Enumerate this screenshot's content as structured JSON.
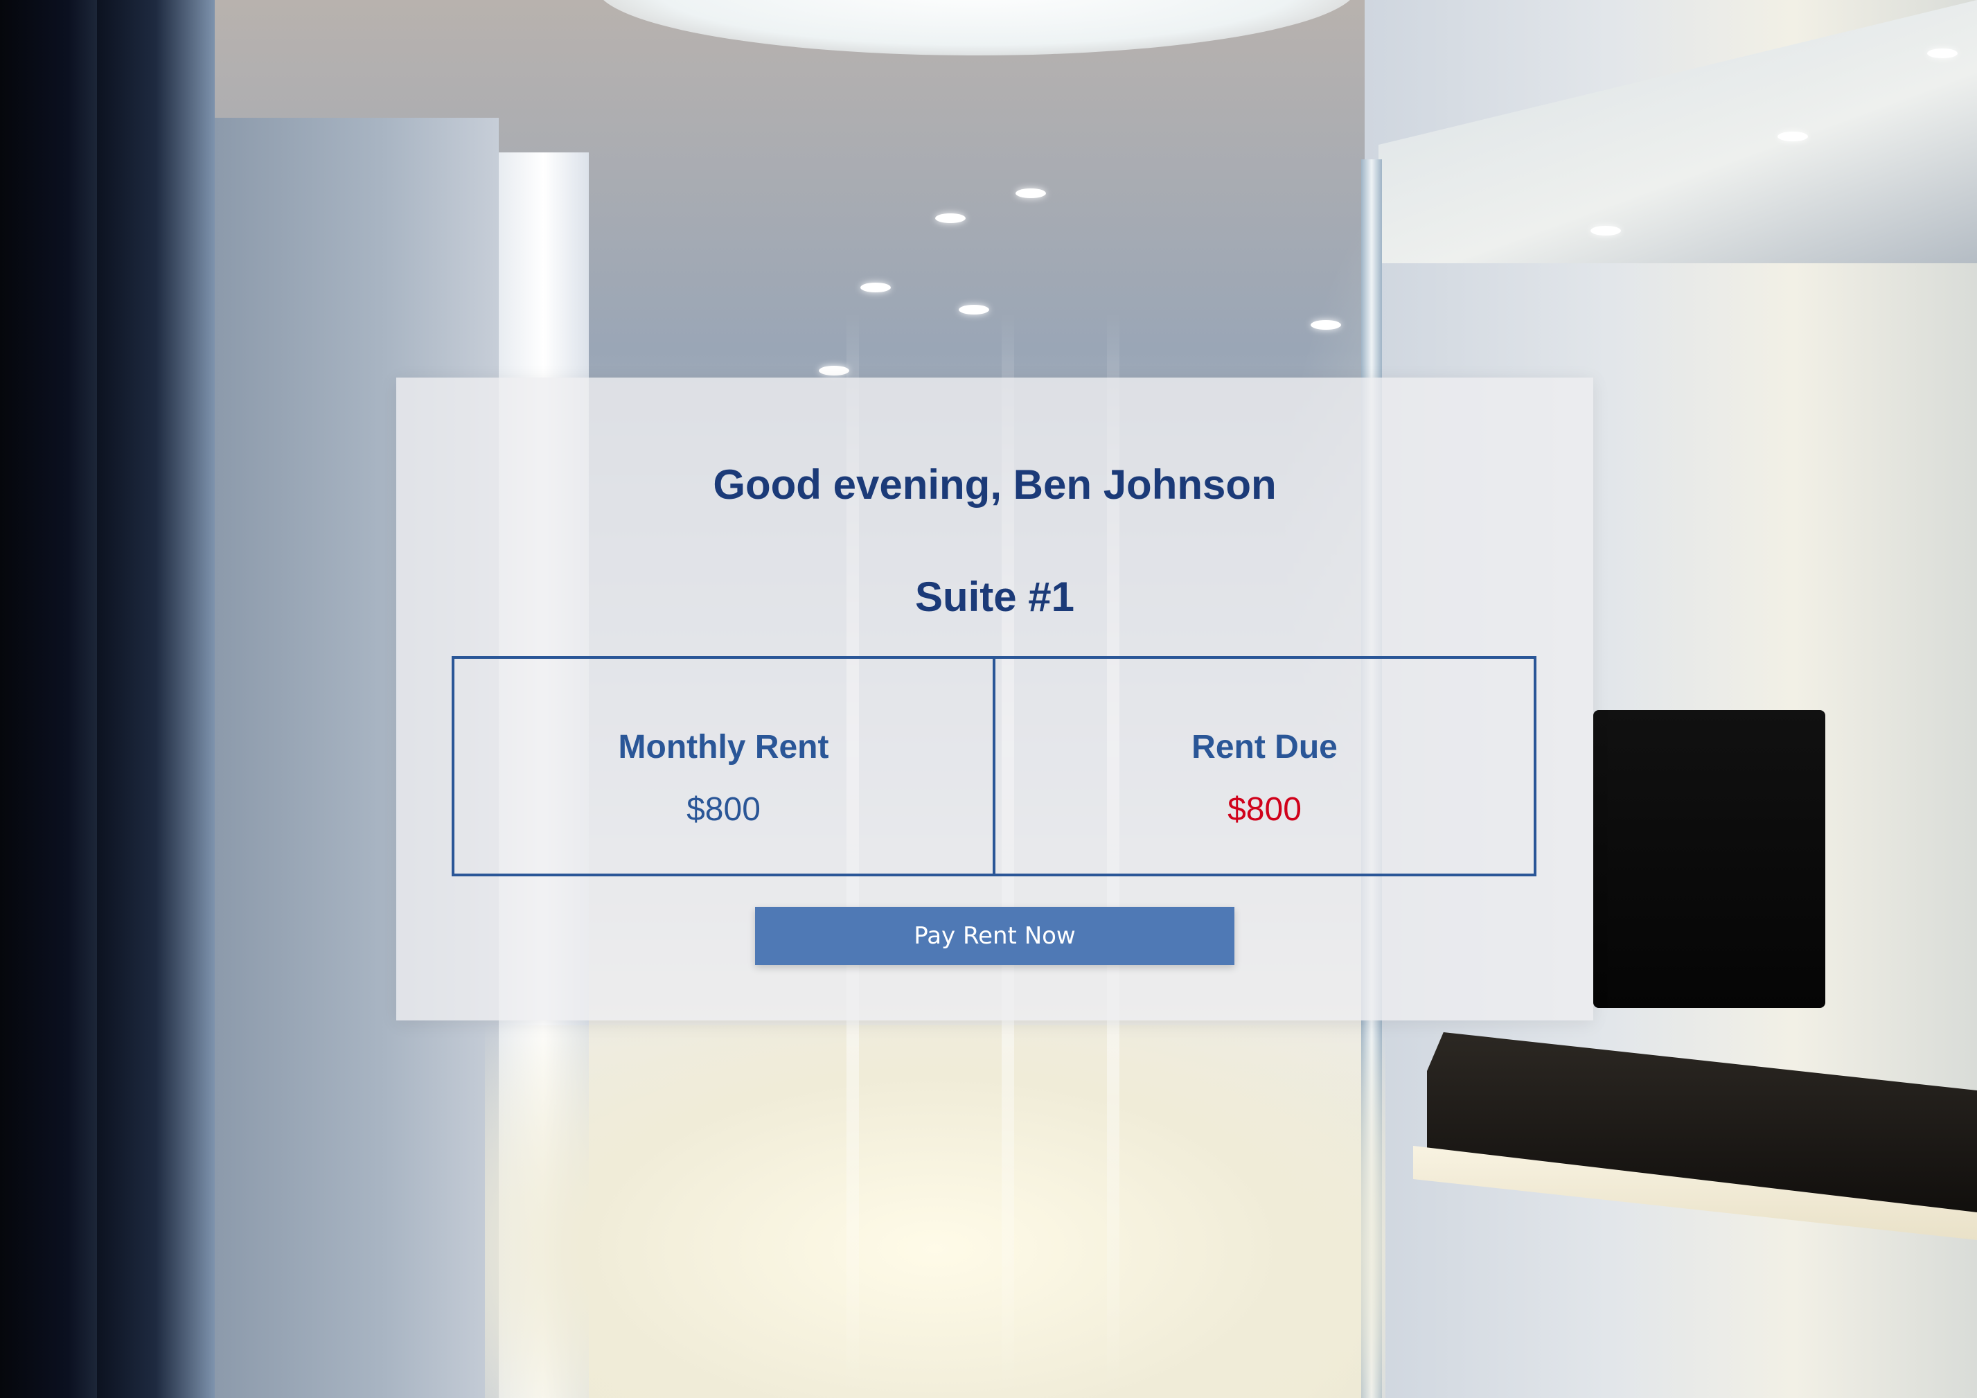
{
  "greeting": "Good evening, Ben Johnson",
  "suite": "Suite #1",
  "rent": {
    "monthly_label": "Monthly Rent",
    "monthly_value": "$800",
    "due_label": "Rent Due",
    "due_value": "$800"
  },
  "actions": {
    "pay_label": "Pay Rent Now"
  },
  "colors": {
    "heading": "#1b3a78",
    "accent": "#2a5697",
    "due": "#d0021b",
    "button": "#4f79b5"
  },
  "background": {
    "description_icon": "interior-hallway-photo"
  }
}
